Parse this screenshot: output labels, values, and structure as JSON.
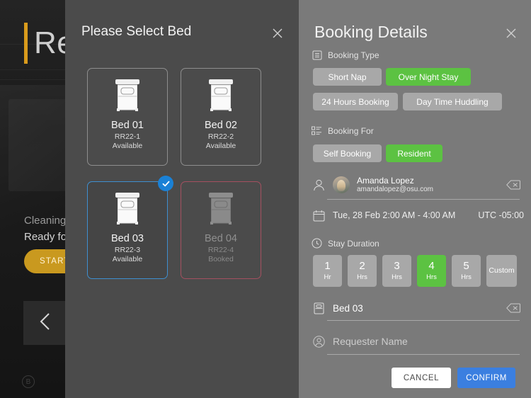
{
  "background": {
    "title": "Res",
    "accent_color": "#d99b1c",
    "status_line1": "Cleaning S",
    "status_line2": "Ready for",
    "cta_label": "START CL",
    "back_icon": "chevron-left-icon",
    "corner_icon": "brand-badge-icon"
  },
  "bed_modal": {
    "title": "Please Select Bed",
    "close_icon": "close-icon",
    "beds": [
      {
        "name": "Bed 01",
        "code": "RR22-1",
        "status": "Available",
        "state": "available"
      },
      {
        "name": "Bed 02",
        "code": "RR22-2",
        "status": "Available",
        "state": "available"
      },
      {
        "name": "Bed 03",
        "code": "RR22-3",
        "status": "Available",
        "state": "selected"
      },
      {
        "name": "Bed 04",
        "code": "RR22-4",
        "status": "Booked",
        "state": "booked"
      }
    ],
    "selected_check_icon": "check-icon",
    "selected_color": "#1a81d6",
    "booked_border_color": "#a45060"
  },
  "details": {
    "title": "Booking Details",
    "close_icon": "close-icon",
    "accent_green": "#5cc242",
    "confirm_blue": "#3b7fe0",
    "booking_type": {
      "label": "Booking Type",
      "icon": "list-lines-icon",
      "options": [
        {
          "label": "Short Nap",
          "selected": false
        },
        {
          "label": "Over Night Stay",
          "selected": true
        },
        {
          "label": "24 Hours Booking",
          "selected": false
        },
        {
          "label": "Day Time Huddling",
          "selected": false
        }
      ]
    },
    "booking_for": {
      "label": "Booking For",
      "icon": "checklist-icon",
      "options": [
        {
          "label": "Self Booking",
          "selected": false
        },
        {
          "label": "Resident",
          "selected": true
        }
      ]
    },
    "user": {
      "icon": "user-outline-icon",
      "avatar": "avatar",
      "name": "Amanda Lopez",
      "email": "amandalopez@osu.com",
      "clear_icon": "backspace-icon"
    },
    "schedule": {
      "icon": "calendar-icon",
      "date_time": "Tue, 28 Feb 2:00 AM - 4:00 AM",
      "timezone": "UTC -05:00"
    },
    "stay_duration": {
      "label": "Stay Duration",
      "icon": "clock-icon",
      "options": [
        {
          "num": "1",
          "unit": "Hr",
          "selected": false
        },
        {
          "num": "2",
          "unit": "Hrs",
          "selected": false
        },
        {
          "num": "3",
          "unit": "Hrs",
          "selected": false
        },
        {
          "num": "4",
          "unit": "Hrs",
          "selected": true
        },
        {
          "num": "5",
          "unit": "Hrs",
          "selected": false
        },
        {
          "num": "Custom",
          "unit": "",
          "selected": false
        }
      ]
    },
    "bed_field": {
      "icon": "bed-small-icon",
      "value": "Bed 03",
      "clear_icon": "backspace-icon"
    },
    "requester_field": {
      "icon": "person-circle-icon",
      "value": "",
      "placeholder": "Requester Name"
    },
    "actions": {
      "cancel_label": "CANCEL",
      "confirm_label": "CONFIRM"
    }
  }
}
